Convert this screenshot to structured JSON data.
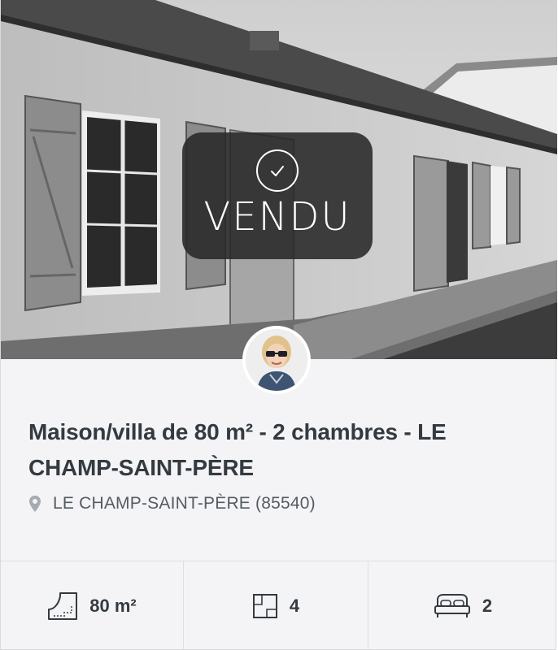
{
  "badge": {
    "status": "VENDU",
    "icon": "check-circle-icon"
  },
  "listing": {
    "title": "Maison/villa de 80 m² - 2 chambres - LE CHAMP-SAINT-PÈRE",
    "location": "LE CHAMP-SAINT-PÈRE (85540)",
    "location_icon": "map-pin-icon"
  },
  "stats": [
    {
      "icon": "surface-area-icon",
      "value": "80 m²"
    },
    {
      "icon": "rooms-floorplan-icon",
      "value": "4"
    },
    {
      "icon": "bed-icon",
      "value": "2"
    }
  ],
  "colors": {
    "badge_background": "#282828",
    "card_background": "#f4f4f6",
    "title_text": "#333a40"
  }
}
